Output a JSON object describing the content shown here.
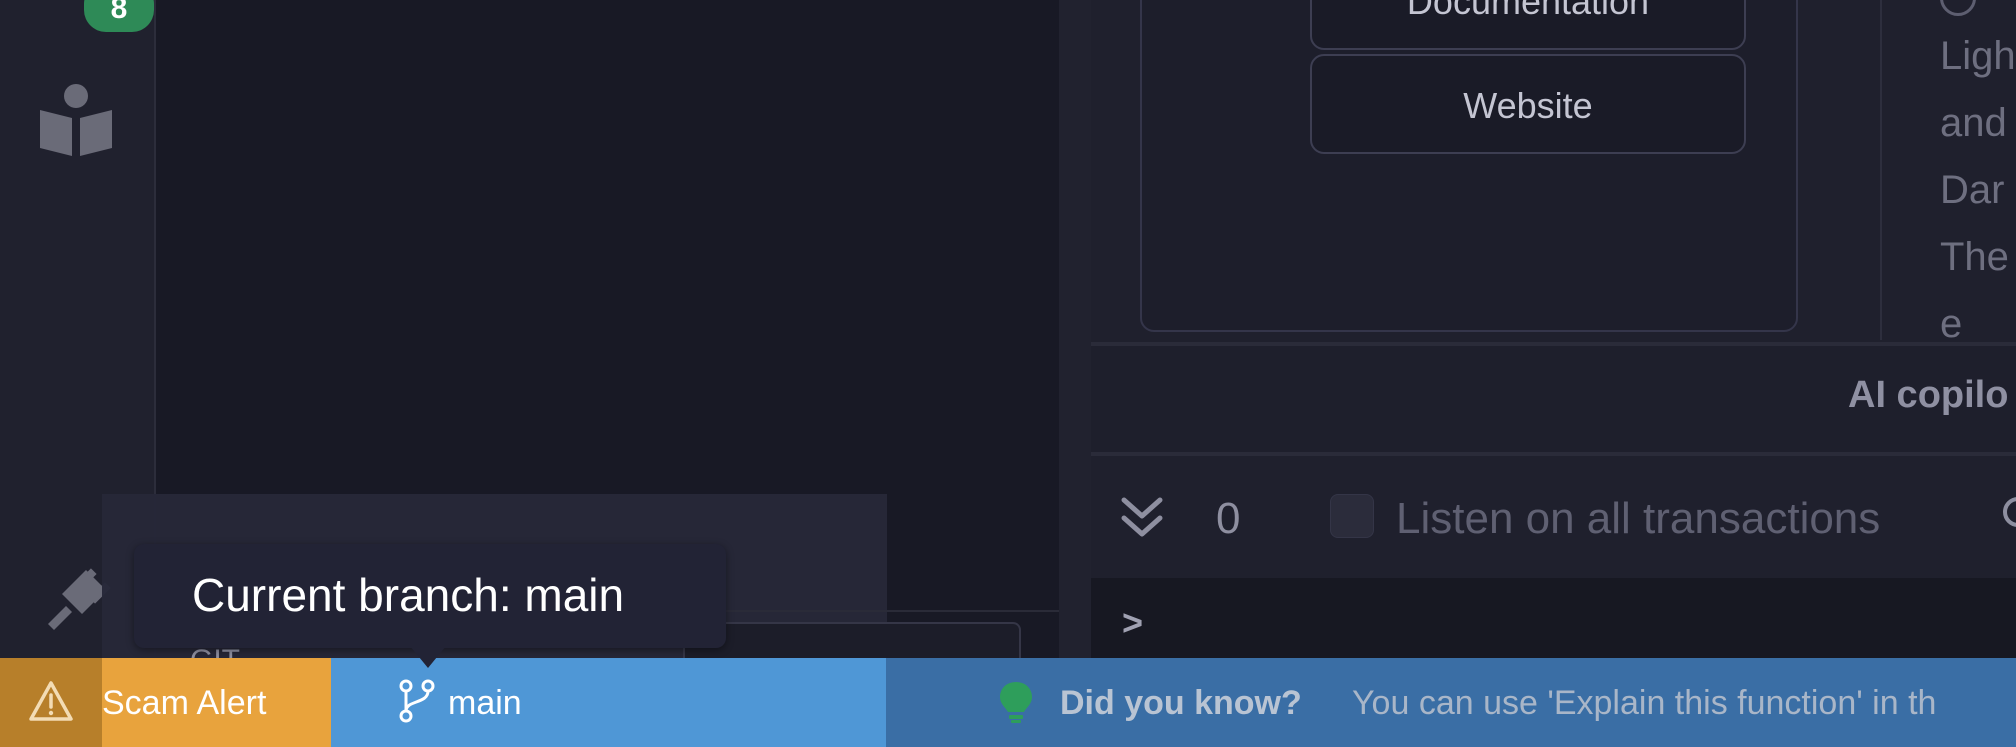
{
  "sidebar": {
    "badge_count": "8",
    "icons": [
      "book-reader-icon",
      "plug-icon"
    ]
  },
  "editor": {
    "git_label": "GIT"
  },
  "right_panel": {
    "buttons": {
      "documentation": "Documentation",
      "website": "Website"
    },
    "theme_words": [
      "Ligh",
      "and",
      "Dar",
      "The",
      "e"
    ],
    "copilot_title": "AI copilo",
    "tx_count": "0",
    "listen_label": "Listen on all transactions",
    "terminal_prompt": ">"
  },
  "statusbar": {
    "scam_label": "Scam Alert",
    "branch": "main",
    "tip_label": "Did you know?",
    "tip_text": "You can use 'Explain this function' in th",
    "colors": {
      "bar": "#3a6ea5",
      "scam": "#e8a33d",
      "branch": "#4f97d6",
      "bulb": "#2e9e5b"
    }
  },
  "tooltip": {
    "text": "Current branch: main"
  }
}
